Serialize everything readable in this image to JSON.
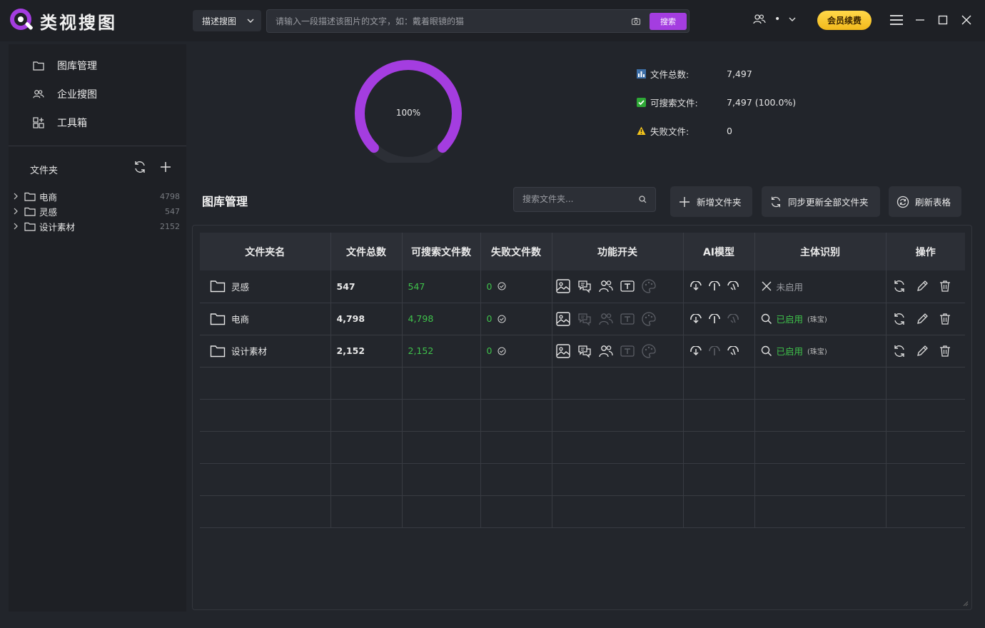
{
  "app": {
    "title": "类视搜图",
    "mode_select": "描述搜图",
    "search_placeholder": "请输入一段描述该图片的文字，如：戴着眼镜的猫",
    "search_button": "搜索",
    "vip_button": "会员续费",
    "user_status": "•",
    "colors": {
      "accent": "#a43de0",
      "success": "#3fc24b",
      "vip": "#f5c22a"
    }
  },
  "sidebar": {
    "nav": [
      {
        "label": "图库管理",
        "icon": "folder-icon"
      },
      {
        "label": "企业搜图",
        "icon": "users-icon"
      },
      {
        "label": "工具箱",
        "icon": "grid-plus-icon"
      }
    ],
    "folder_header": "文件夹",
    "folders": [
      {
        "name": "电商",
        "count": "4798"
      },
      {
        "name": "灵感",
        "count": "547"
      },
      {
        "name": "设计素材",
        "count": "2152"
      }
    ]
  },
  "stats": {
    "gauge_label": "100%",
    "gauge_fraction": 1.0,
    "total_label": "文件总数:",
    "total_value": "7,497",
    "searchable_label": "可搜索文件:",
    "searchable_value": "7,497  (100.0%)",
    "failed_label": "失败文件:",
    "failed_value": "0"
  },
  "library": {
    "title": "图库管理",
    "search_placeholder": "搜索文件夹...",
    "buttons": {
      "add_folder": "新增文件夹",
      "sync_all": "同步更新全部文件夹",
      "refresh": "刷新表格"
    },
    "columns": [
      "文件夹名",
      "文件总数",
      "可搜索文件数",
      "失败文件数",
      "功能开关",
      "AI模型",
      "主体识别",
      "操作"
    ],
    "rows": [
      {
        "name": "灵感",
        "total": "547",
        "searchable": "547",
        "failed": "0",
        "features": [
          true,
          true,
          true,
          true,
          false
        ],
        "models": [
          true,
          true,
          true
        ],
        "subject": "未启用",
        "subject_note": "",
        "subject_enabled": false
      },
      {
        "name": "电商",
        "total": "4,798",
        "searchable": "4,798",
        "failed": "0",
        "features": [
          true,
          false,
          false,
          false,
          false
        ],
        "models": [
          true,
          true,
          false
        ],
        "subject": "已启用",
        "subject_note": "(珠宝)",
        "subject_enabled": true
      },
      {
        "name": "设计素材",
        "total": "2,152",
        "searchable": "2,152",
        "failed": "0",
        "features": [
          true,
          true,
          true,
          false,
          false
        ],
        "models": [
          true,
          false,
          true
        ],
        "subject": "已启用",
        "subject_note": "(珠宝)",
        "subject_enabled": true
      }
    ],
    "empty_rows": 5
  }
}
